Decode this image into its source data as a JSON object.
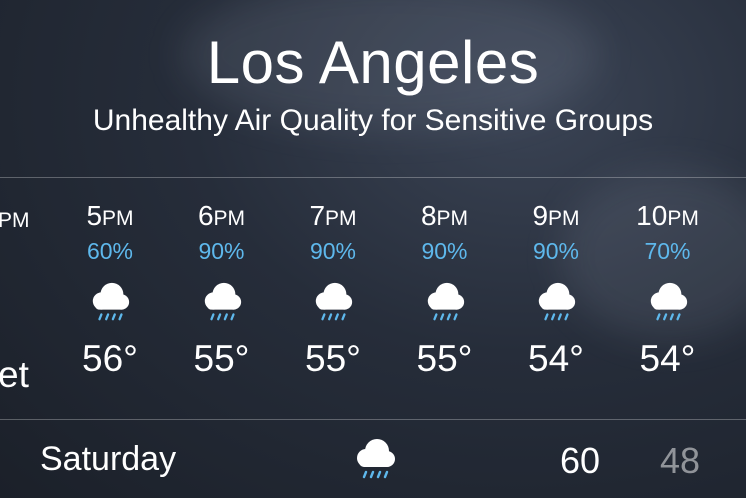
{
  "header": {
    "city": "Los Angeles",
    "condition": "Unhealthy Air Quality for Sensitive Groups"
  },
  "hourly": {
    "partial_left": {
      "time_suffix": "PM",
      "temp_suffix": "et"
    },
    "items": [
      {
        "hour": "5",
        "ampm": "PM",
        "precip": "60%",
        "icon": "rain-cloud-icon",
        "temp": "56°"
      },
      {
        "hour": "6",
        "ampm": "PM",
        "precip": "90%",
        "icon": "rain-cloud-icon",
        "temp": "55°"
      },
      {
        "hour": "7",
        "ampm": "PM",
        "precip": "90%",
        "icon": "rain-cloud-icon",
        "temp": "55°"
      },
      {
        "hour": "8",
        "ampm": "PM",
        "precip": "90%",
        "icon": "rain-cloud-icon",
        "temp": "55°"
      },
      {
        "hour": "9",
        "ampm": "PM",
        "precip": "90%",
        "icon": "rain-cloud-icon",
        "temp": "54°"
      },
      {
        "hour": "10",
        "ampm": "PM",
        "precip": "70%",
        "icon": "rain-cloud-icon",
        "temp": "54°"
      }
    ]
  },
  "daily": {
    "day": "Saturday",
    "icon": "rain-cloud-icon",
    "high": "60",
    "low": "48"
  },
  "colors": {
    "precip_blue": "#5eb8ec",
    "low_temp_gray": "#8a8f98"
  }
}
